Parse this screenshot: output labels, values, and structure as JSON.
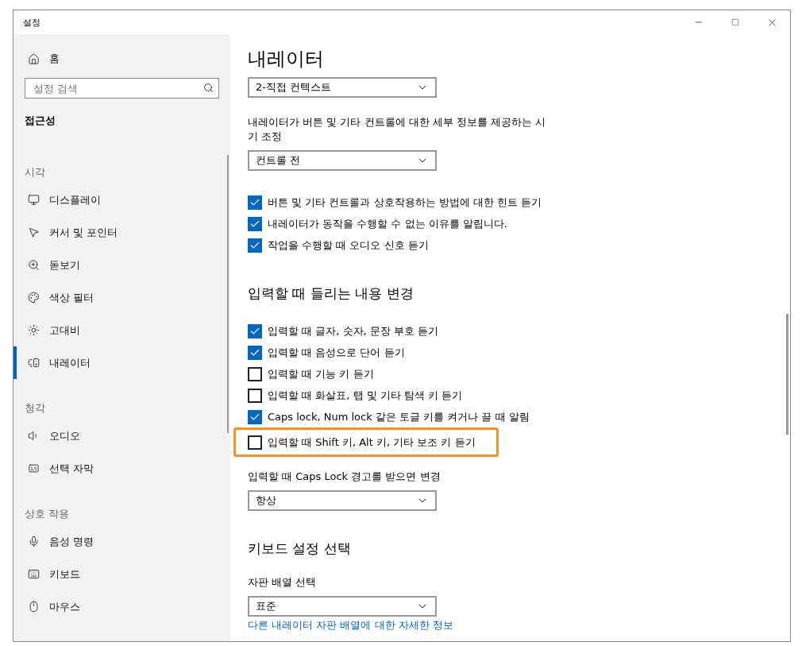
{
  "window": {
    "title": "설정"
  },
  "sidebar": {
    "home": "홈",
    "search": {
      "placeholder": "설정 검색"
    },
    "category": "접근성",
    "groups": [
      {
        "heading": "시각",
        "items": [
          {
            "label": "디스플레이",
            "selected": false
          },
          {
            "label": "커서 및 포인터",
            "selected": false
          },
          {
            "label": "돋보기",
            "selected": false
          },
          {
            "label": "색상 필터",
            "selected": false
          },
          {
            "label": "고대비",
            "selected": false
          },
          {
            "label": "내레이터",
            "selected": true
          }
        ]
      },
      {
        "heading": "청각",
        "items": [
          {
            "label": "오디오",
            "selected": false
          },
          {
            "label": "선택 자막",
            "selected": false
          }
        ]
      },
      {
        "heading": "상호 작용",
        "items": [
          {
            "label": "음성 명령",
            "selected": false
          },
          {
            "label": "키보드",
            "selected": false
          },
          {
            "label": "마우스",
            "selected": false
          }
        ]
      }
    ]
  },
  "main": {
    "title": "내레이터",
    "blocks": [
      {
        "kind": "dropdown",
        "value": "2-직접 컨텍스트"
      },
      {
        "kind": "label",
        "text": "내레이터가 버튼 및 기타 컨트롤에 대한 세부 정보를 제공하는 시기 조정"
      },
      {
        "kind": "dropdown",
        "value": "컨트롤 전"
      },
      {
        "kind": "checks",
        "items": [
          {
            "label": "버튼 및 기타 컨트롤과 상호작용하는 방법에 대한 힌트 듣기",
            "checked": true,
            "highlighted": false
          },
          {
            "label": "내레이터가 동작을 수행할 수 없는 이유를 알립니다.",
            "checked": true,
            "highlighted": false
          },
          {
            "label": "작업을 수행할 때 오디오 신호 듣기",
            "checked": true,
            "highlighted": false
          }
        ]
      },
      {
        "kind": "heading",
        "text": "입력할 때 들리는 내용 변경"
      },
      {
        "kind": "checks",
        "items": [
          {
            "label": "입력할 때 글자, 숫자, 문장 부호 듣기",
            "checked": true,
            "highlighted": false
          },
          {
            "label": "입력할 때 음성으로 단어 듣기",
            "checked": true,
            "highlighted": false
          },
          {
            "label": "입력할 때 기능 키 듣기",
            "checked": false,
            "highlighted": false
          },
          {
            "label": "입력할 때 화살표, 탭 및 기타 탐색 키 듣기",
            "checked": false,
            "highlighted": false
          },
          {
            "label": "Caps lock, Num lock 같은 토글 키를 켜거나 끌 때 알림",
            "checked": true,
            "highlighted": false
          },
          {
            "label": "입력할 때 Shift 키, Alt 키, 기타 보조 키 듣기",
            "checked": false,
            "highlighted": true
          }
        ]
      },
      {
        "kind": "label",
        "text": "입력할 때 Caps Lock 경고를 받으면 변경"
      },
      {
        "kind": "dropdown",
        "value": "항상"
      },
      {
        "kind": "heading",
        "text": "키보드 설정 선택"
      },
      {
        "kind": "label",
        "text": "자판 배열 선택"
      },
      {
        "kind": "dropdown",
        "value": "표준"
      },
      {
        "kind": "link",
        "text": "다른 내레이터 자판 배열에 대한 자세한 정보"
      }
    ]
  }
}
